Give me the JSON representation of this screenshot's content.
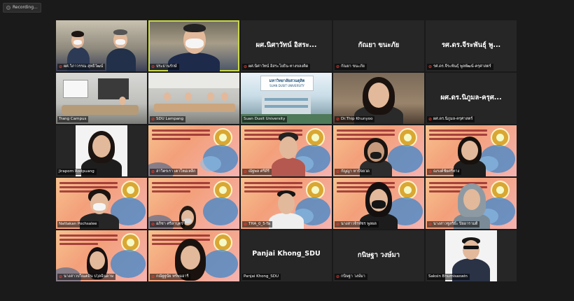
{
  "recording": {
    "label": "Recording..."
  },
  "colors": {
    "active_speaker": "#c9d84a",
    "muted_mic": "#ff3b30",
    "brand_orange": "#f3a07a",
    "brand_blue": "#3f86c8"
  },
  "tiles": [
    {
      "name": "ผศ.วิภาวรรณ สุทธิวัฒน์",
      "muted": true
    },
    {
      "name": "ประธานรักษ์",
      "muted": true
    },
    {
      "name": "ผศ.นิศาวัทน์ อิสระโยธิน-ทางขลงคิด",
      "center": "ผศ.นิศาวัทน์ อิสระ...",
      "muted": true
    },
    {
      "name": "กัณยา ขนะภัย",
      "center": "กัณยา ขนะภัย",
      "muted": true
    },
    {
      "name": "รศ.ดร.จีระพันธุ์ พูลพัฒน์-ครุศาสตร์",
      "center": "รศ.ดร.จีระพันธุ์ พู...",
      "muted": true
    },
    {
      "name": "Trang Campus",
      "muted": false
    },
    {
      "name": "SDU Lampang",
      "muted": true
    },
    {
      "name": "Suan Dusit University",
      "muted": false,
      "sign": "มหาวิทยาลัยสวนดุสิต",
      "sign_en": "SUAN DUSIT UNIVERSITY"
    },
    {
      "name": "Dr.Thip Khunyoo",
      "muted": true
    },
    {
      "name": "ผศ.ดร.นิภูมล-ครุศาสตร์",
      "center": "ผศ.ดร.นิภูมล-ครุศ...",
      "muted": true
    },
    {
      "name": "Jiraporn Rodpuang",
      "muted": false
    },
    {
      "name": "สาวิตรเรา เตาใหม่เหล็ก",
      "muted": true,
      "brand": true
    },
    {
      "name": "ณัฐพล ศรีดีรี",
      "muted": true,
      "brand": true
    },
    {
      "name": "กัญญา หาปัจยวด",
      "muted": true,
      "brand": true
    },
    {
      "name": "ณรงค์ชัยศรีทาง",
      "muted": true,
      "brand": true
    },
    {
      "name": "Nattakan Pochsalee",
      "muted": false,
      "brand": true
    },
    {
      "name": "อภิชา ศรีลาบุตร",
      "muted": true,
      "brand": true
    },
    {
      "name": "THA_0_5-Ta",
      "muted": true,
      "brand": true
    },
    {
      "name": "นางสาวจิรพัชร พูลผล",
      "muted": true,
      "brand": true
    },
    {
      "name": "นางสาวซูลรีย๊ะ ปิยอารามดี",
      "muted": true,
      "brand": true
    },
    {
      "name": "นางสาวปวิณตลิ่น ปวุลฉินดาษ",
      "muted": true,
      "brand": true
    },
    {
      "name": "กณัฐฐนัย ทรัพมอารี",
      "muted": true,
      "brand": true
    },
    {
      "name": "Panjai Khong_SDU",
      "center": "Panjai Khong_SDU",
      "muted": false
    },
    {
      "name": "กนิษฐา วงษ์มา",
      "center": "กนิษฐา วงษ์มา",
      "muted": true
    },
    {
      "name": "Saksin Bhumisaswin",
      "muted": false
    }
  ],
  "brand_text": [
    "หลักสูตรศึกษาศาสตรมหาบัณฑิต",
    "สาขาวิชาการจัดการการศึกษาปฐมวัย",
    "และประถมศึกษา"
  ]
}
